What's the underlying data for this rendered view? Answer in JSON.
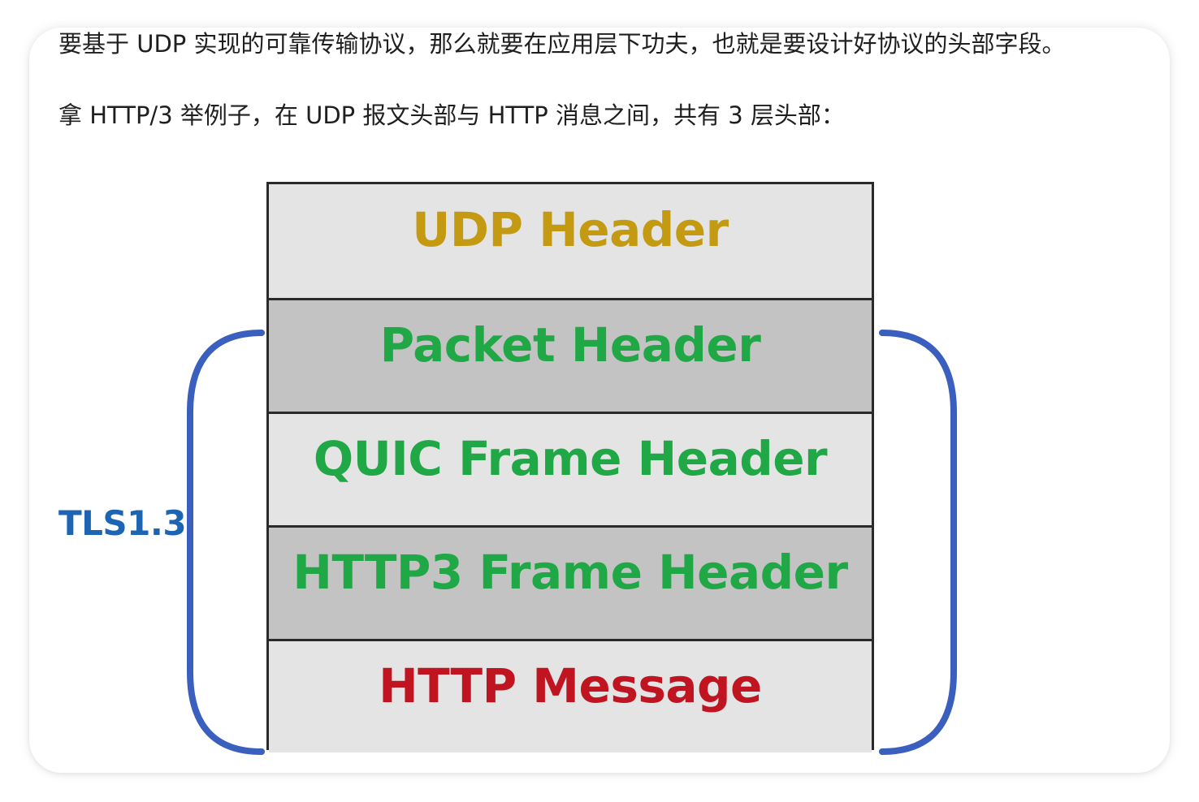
{
  "paragraphs": {
    "line1": "要基于 UDP 实现的可靠传输协议，那么就要在应用层下功夫，也就是要设计好协议的头部字段。",
    "line2": "拿 HTTP/3 举例子，在 UDP 报文头部与 HTTP 消息之间，共有 3 层头部："
  },
  "diagram": {
    "layers": [
      {
        "label": "UDP Header",
        "color": "#c39a12"
      },
      {
        "label": "Packet Header",
        "color": "#1fa845"
      },
      {
        "label": "QUIC Frame Header",
        "color": "#1fa845"
      },
      {
        "label": "HTTP3 Frame Header",
        "color": "#1fa845"
      },
      {
        "label": "HTTP Message",
        "color": "#c01520"
      }
    ],
    "bracket_label": "TLS1.3",
    "bracket_label_color": "#1d64b3",
    "bracket_color": "#3a5fbf"
  }
}
